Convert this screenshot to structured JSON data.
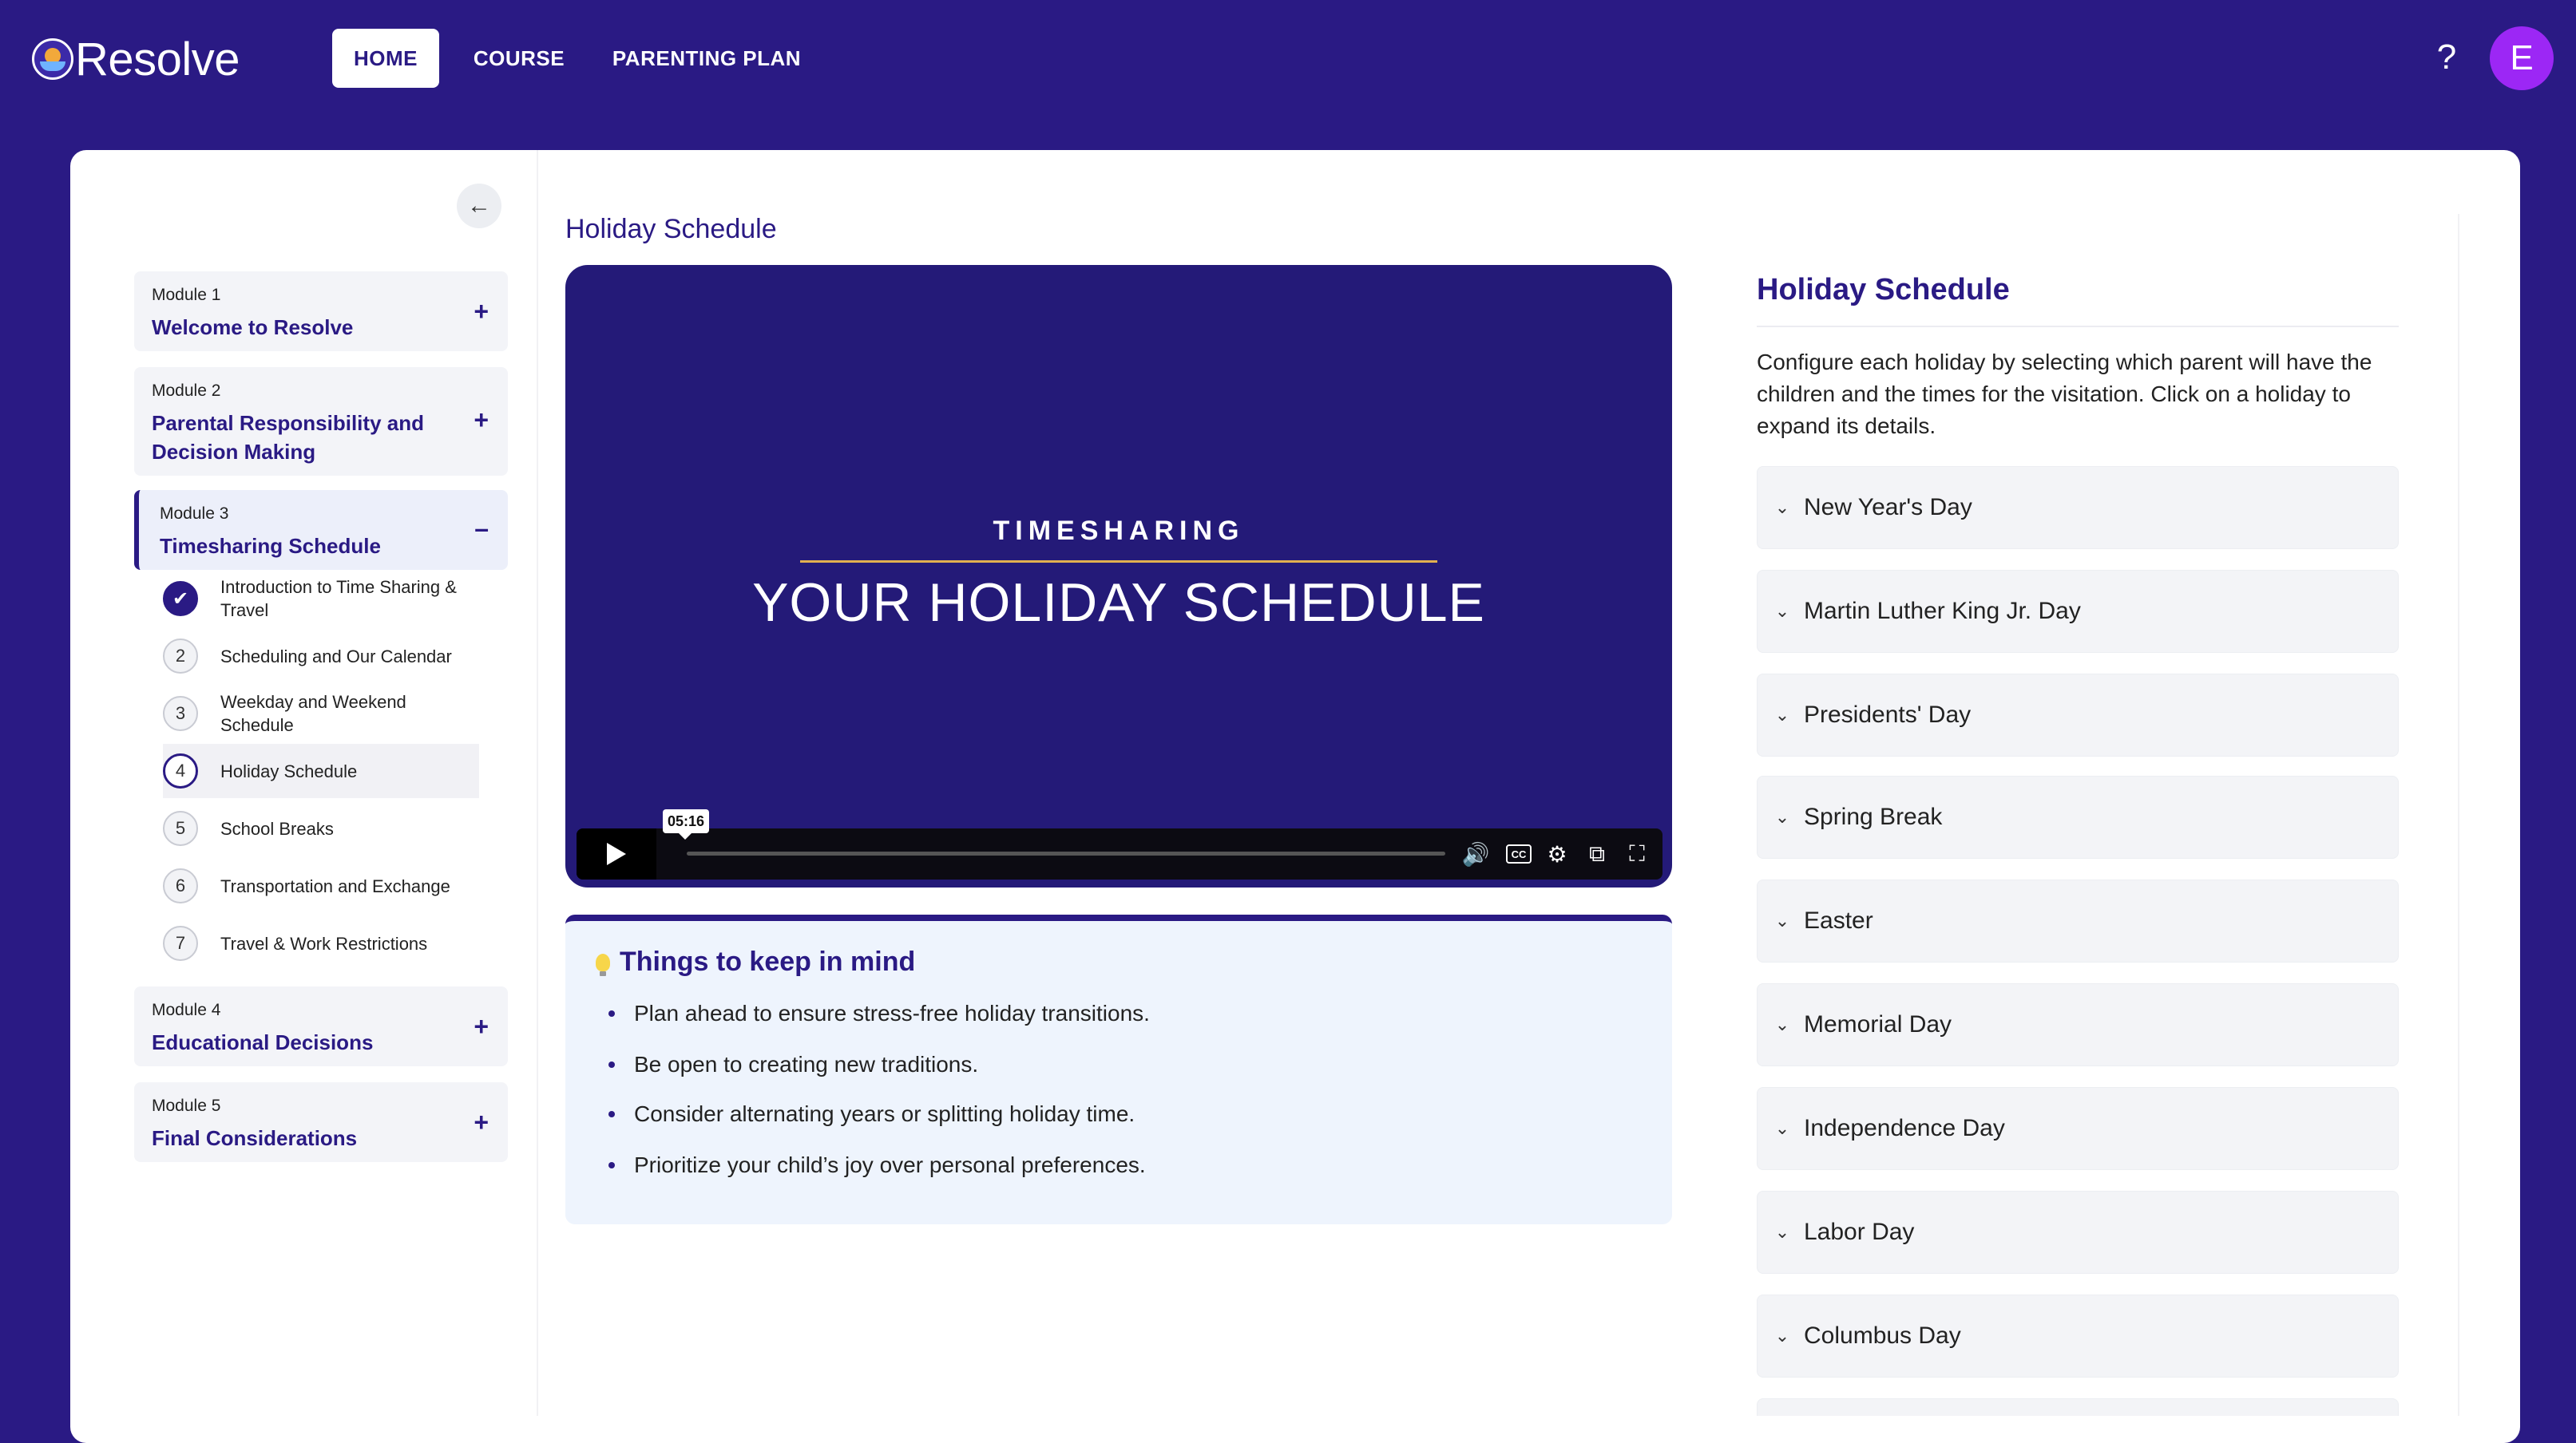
{
  "app": {
    "name": "Resolve",
    "nav": [
      {
        "label": "HOME",
        "active": true
      },
      {
        "label": "COURSE",
        "active": false
      },
      {
        "label": "PARENTING PLAN",
        "active": false
      }
    ],
    "help_label": "?",
    "avatar_initial": "E"
  },
  "sidebar": {
    "modules": [
      {
        "small": "Module 1",
        "title": "Welcome to Resolve",
        "toggle": "+"
      },
      {
        "small": "Module 2",
        "title": "Parental Responsibility and Decision Making",
        "toggle": "+"
      },
      {
        "small": "Module 3",
        "title": "Timesharing Schedule",
        "toggle": "–",
        "lessons": [
          {
            "num": "✔",
            "label": "Introduction to Time Sharing & Travel",
            "status": "done"
          },
          {
            "num": "2",
            "label": "Scheduling and Our Calendar",
            "status": "todo"
          },
          {
            "num": "3",
            "label": "Weekday and Weekend Schedule",
            "status": "todo"
          },
          {
            "num": "4",
            "label": "Holiday Schedule",
            "status": "current"
          },
          {
            "num": "5",
            "label": "School Breaks",
            "status": "todo"
          },
          {
            "num": "6",
            "label": "Transportation and Exchange",
            "status": "todo"
          },
          {
            "num": "7",
            "label": "Travel & Work Restrictions",
            "status": "todo"
          }
        ]
      },
      {
        "small": "Module 4",
        "title": "Educational Decisions",
        "toggle": "+"
      },
      {
        "small": "Module 5",
        "title": "Final Considerations",
        "toggle": "+"
      }
    ]
  },
  "main": {
    "title": "Holiday Schedule",
    "video": {
      "subtitle": "TIMESHARING",
      "title": "YOUR HOLIDAY SCHEDULE",
      "time_tooltip": "05:16",
      "cc_label": "CC",
      "progress": 0
    },
    "tips": {
      "title": "Things to keep in mind",
      "items": [
        "Plan ahead to ensure stress-free holiday transitions.",
        "Be open to creating new traditions.",
        "Consider alternating years or splitting holiday time.",
        "Prioritize your child’s joy over personal preferences."
      ]
    }
  },
  "right_panel": {
    "title": "Holiday Schedule",
    "description": "Configure each holiday by selecting which parent will have the children and the times for the visitation. Click on a holiday to expand its details.",
    "holidays": [
      "New Year's Day",
      "Martin Luther King Jr. Day",
      "Presidents' Day",
      "Spring Break",
      "Easter",
      "Memorial Day",
      "Independence Day",
      "Labor Day",
      "Columbus Day"
    ]
  },
  "colors": {
    "brand": "#2a1a84",
    "accent_gold": "#e2b050",
    "avatar": "#9c27f5"
  }
}
